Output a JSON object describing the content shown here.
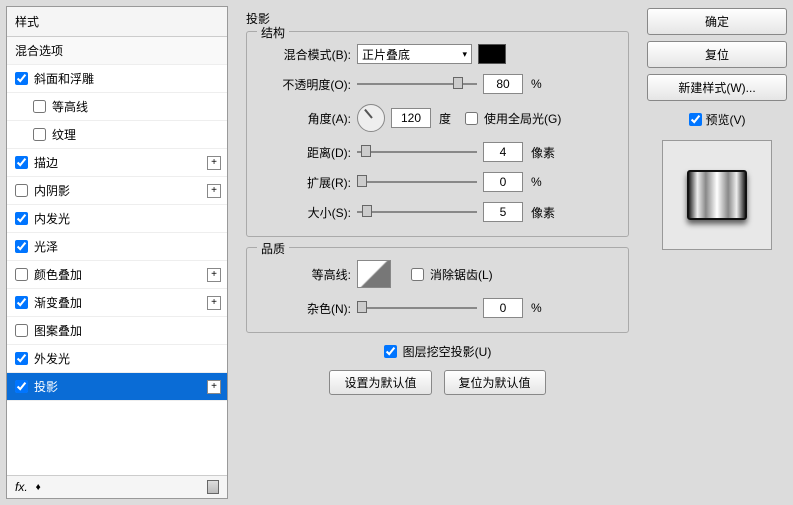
{
  "left": {
    "header": "样式",
    "blending_options": "混合选项",
    "items": [
      {
        "label": "斜面和浮雕",
        "checked": true,
        "plus": false
      },
      {
        "label": "等高线",
        "checked": false,
        "plus": false,
        "indent": true
      },
      {
        "label": "纹理",
        "checked": false,
        "plus": false,
        "indent": true
      },
      {
        "label": "描边",
        "checked": true,
        "plus": true
      },
      {
        "label": "内阴影",
        "checked": false,
        "plus": true
      },
      {
        "label": "内发光",
        "checked": true,
        "plus": false
      },
      {
        "label": "光泽",
        "checked": true,
        "plus": false
      },
      {
        "label": "颜色叠加",
        "checked": false,
        "plus": true
      },
      {
        "label": "渐变叠加",
        "checked": true,
        "plus": true
      },
      {
        "label": "图案叠加",
        "checked": false,
        "plus": false
      },
      {
        "label": "外发光",
        "checked": true,
        "plus": false
      },
      {
        "label": "投影",
        "checked": true,
        "plus": true,
        "selected": true
      }
    ],
    "footer_fx": "fx."
  },
  "center": {
    "title": "投影",
    "structure_title": "结构",
    "blend_mode_label": "混合模式(B):",
    "blend_mode_value": "正片叠底",
    "opacity_label": "不透明度(O):",
    "opacity_value": "80",
    "opacity_unit": "%",
    "angle_label": "角度(A):",
    "angle_value": "120",
    "angle_unit": "度",
    "global_light_label": "使用全局光(G)",
    "distance_label": "距离(D):",
    "distance_value": "4",
    "distance_unit": "像素",
    "spread_label": "扩展(R):",
    "spread_value": "0",
    "spread_unit": "%",
    "size_label": "大小(S):",
    "size_value": "5",
    "size_unit": "像素",
    "quality_title": "品质",
    "contour_label": "等高线:",
    "antialias_label": "消除锯齿(L)",
    "noise_label": "杂色(N):",
    "noise_value": "0",
    "noise_unit": "%",
    "knockout_label": "图层挖空投影(U)",
    "set_default": "设置为默认值",
    "reset_default": "复位为默认值"
  },
  "right": {
    "ok": "确定",
    "reset": "复位",
    "new_style": "新建样式(W)...",
    "preview": "预览(V)"
  }
}
